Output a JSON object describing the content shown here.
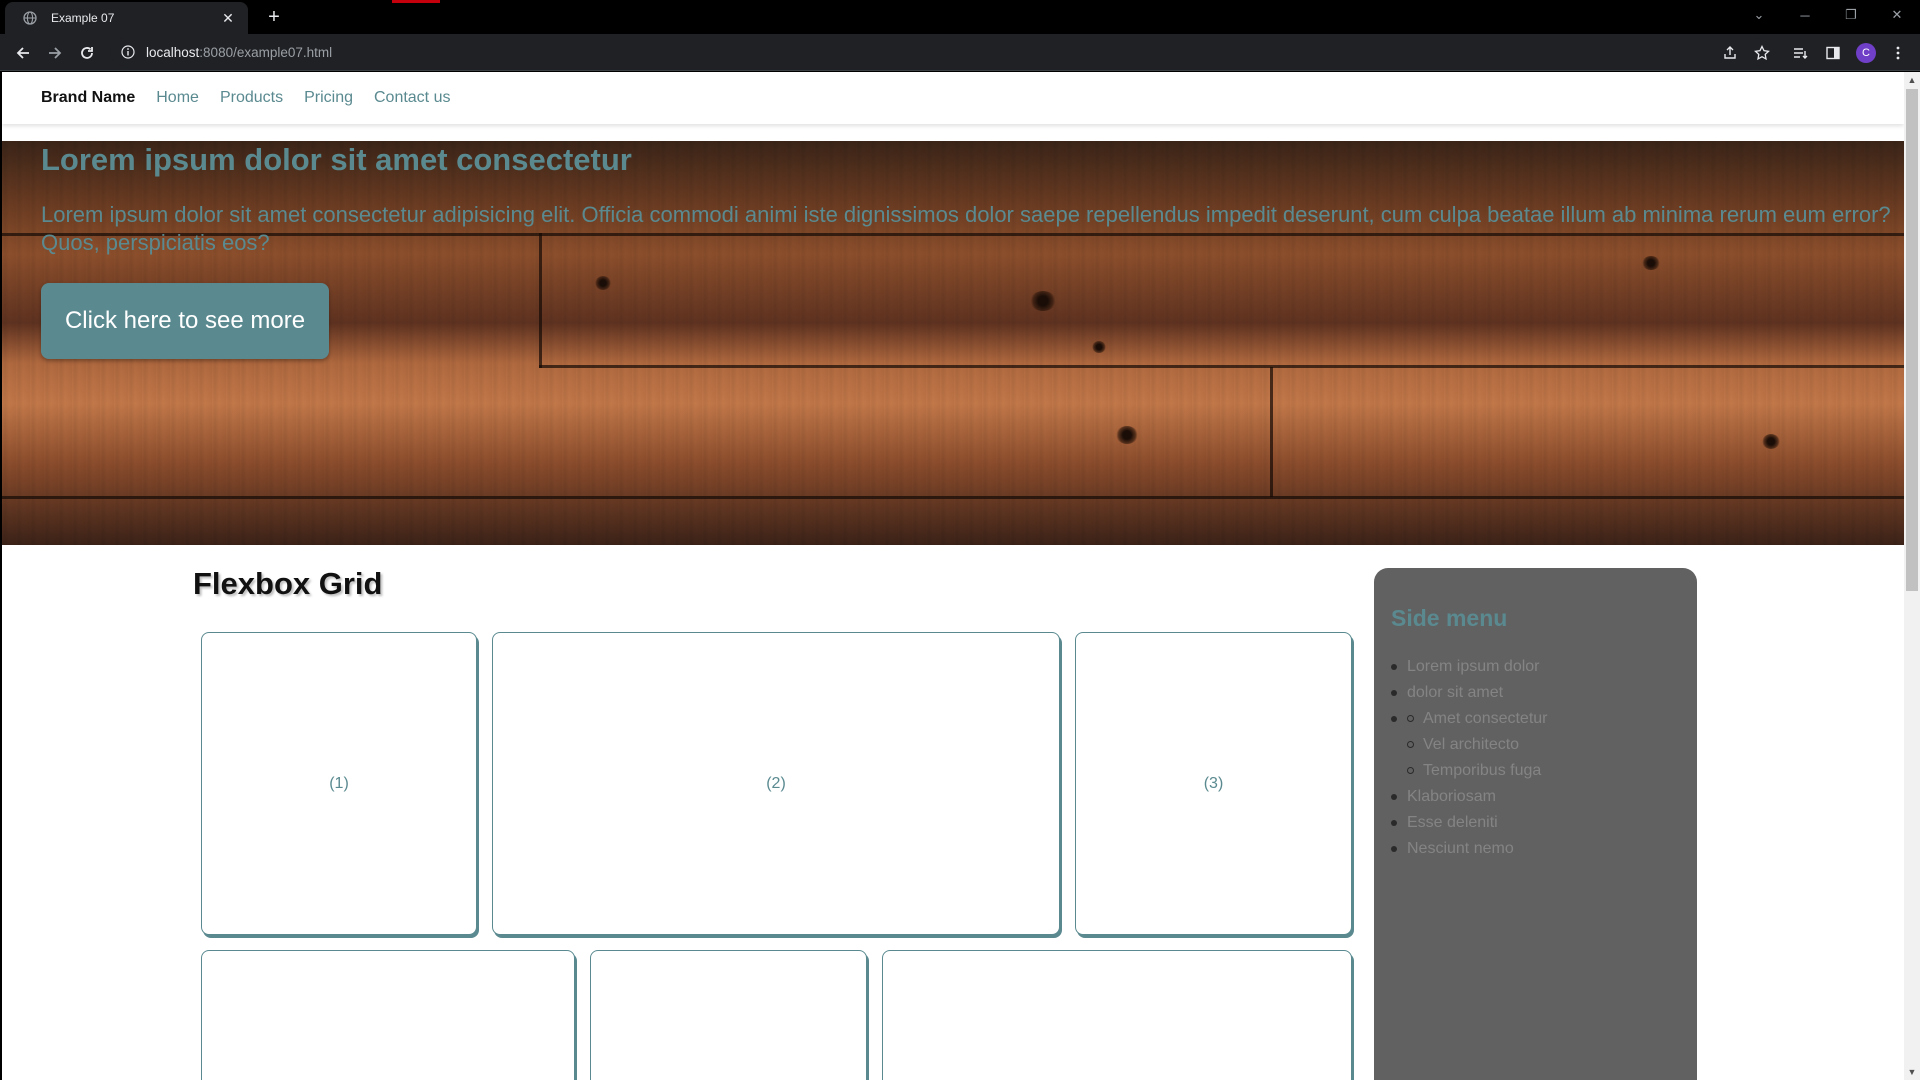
{
  "browser": {
    "tab_title": "Example 07",
    "url_host": "localhost",
    "url_rest": ":8080/example07.html",
    "profile_initial": "C"
  },
  "nav": {
    "brand": "Brand Name",
    "links": [
      "Home",
      "Products",
      "Pricing",
      "Contact us"
    ]
  },
  "hero": {
    "title": "Lorem ipsum dolor sit amet consectetur",
    "text": "Lorem ipsum dolor sit amet consectetur adipisicing elit. Officia commodi animi iste dignissimos dolor saepe repellendus impedit deserunt, cum culpa beatae illum ab minima rerum eum error? Quos, perspiciatis eos?",
    "button": "Click here to see more"
  },
  "grid": {
    "title": "Flexbox Grid",
    "row1": [
      "(1)",
      "(2)",
      "(3)"
    ]
  },
  "side_menu": {
    "title": "Side menu",
    "items": [
      "Lorem ipsum dolor",
      "dolor sit amet",
      "Amet consectetur",
      "Vel architecto",
      "Temporibus fuga",
      "Klaboriosam",
      "Esse deleniti",
      "Nesciunt nemo"
    ]
  },
  "colors": {
    "accent": "#5a8a90",
    "side_menu_bg": "#616161"
  }
}
